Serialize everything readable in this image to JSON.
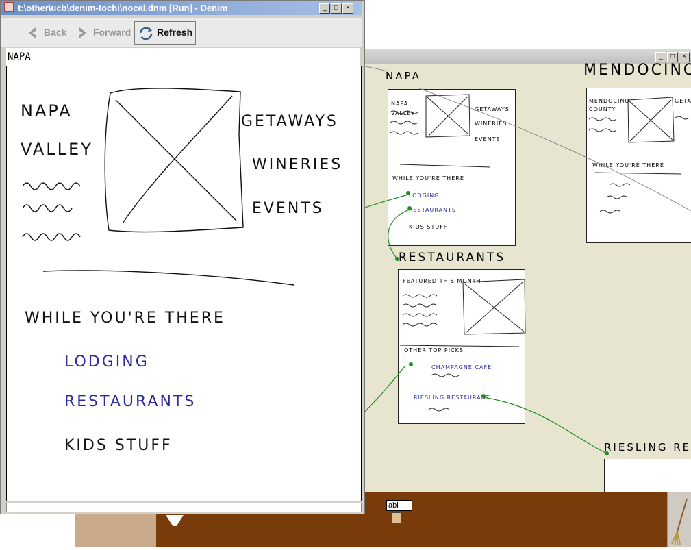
{
  "window": {
    "title": "t:\\other\\ucb\\denim-tochi\\nocal.dnm [Run] - Denim",
    "controls": [
      "_",
      "□",
      "×"
    ]
  },
  "nav": {
    "back_label": "Back",
    "forward_label": "Forward",
    "refresh_label": "Refresh"
  },
  "page_name": "NAPA",
  "page": {
    "heading_line1": "NAPA",
    "heading_line2": "VALLEY",
    "links_right": [
      "GETAWAYS",
      "WINERIES",
      "EVENTS"
    ],
    "section_title": "WHILE YOU'RE THERE",
    "links": [
      {
        "label": "LODGING",
        "color": "#2b2b9e"
      },
      {
        "label": "RESTAURANTS",
        "color": "#2b2b9e"
      },
      {
        "label": "KIDS STUFF",
        "color": "#111111"
      }
    ]
  },
  "background": {
    "controls": [
      "_",
      "□",
      "×"
    ],
    "page_napa_label": "NAPA",
    "page_mendocino_label": "MENDOCINO",
    "page_restaurants_label": "RESTAURANTS",
    "page_riesling_label": "RIESLING REST",
    "napa_card": {
      "left_text": [
        "NAPA",
        "VALLEY"
      ],
      "right_text": [
        "GETAWAYS",
        "WINERIES",
        "EVENTS"
      ],
      "section": "WHILE YOU'RE THERE",
      "links": [
        "LODGING",
        "RESTAURANTS",
        "KIDS STUFF"
      ]
    },
    "mendocino_card": {
      "left_text": [
        "MENDOCINO",
        "COUNTY"
      ],
      "right_text": "GETA",
      "section": "WHILE YOU'RE THERE"
    },
    "restaurants_card": {
      "featured": "FEATURED THIS MONTH",
      "other": "OTHER TOP PICKS",
      "item1": "CHAMPAGNE CAFE",
      "item2": "RIESLING RESTAURANT"
    }
  },
  "toolbar": {
    "text_tool_label": "abl"
  },
  "colors": {
    "link_green": "#1e8c1e",
    "link_blue": "#2b2b9e",
    "denim_bg": "#e7e4cf",
    "toolbar_brown": "#7a3b0a"
  }
}
